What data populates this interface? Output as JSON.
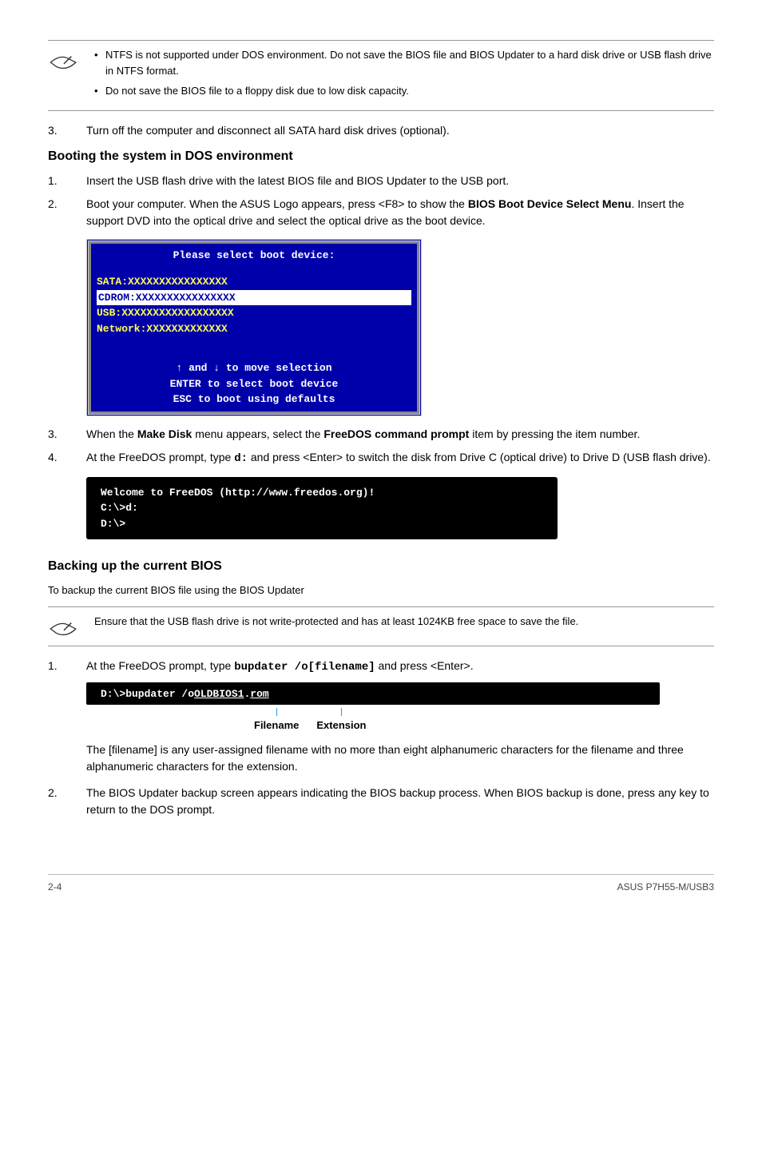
{
  "notes": {
    "top": {
      "items": [
        "NTFS is not supported under DOS environment. Do not save the BIOS file and BIOS Updater to a hard disk drive or USB flash drive in NTFS format.",
        "Do not save the BIOS file to a floppy disk due to low disk capacity."
      ]
    },
    "backup": {
      "text": "Ensure that the USB flash drive is not write-protected and has at least 1024KB free space to save the file."
    }
  },
  "step3": "Turn off the computer and disconnect all SATA hard disk drives (optional).",
  "booting": {
    "heading": "Booting the system in DOS environment",
    "steps": {
      "s1": "Insert the USB flash drive with the latest BIOS file and BIOS Updater to the USB port.",
      "s2_a": "Boot your computer. When the ASUS Logo appears, press <F8> to show the ",
      "s2_bold": "BIOS Boot Device Select Menu",
      "s2_b": ". Insert the support DVD into the optical drive and select the optical drive as the boot device.",
      "s3_a": "When the ",
      "s3_bold1": "Make Disk",
      "s3_b": " menu appears, select the ",
      "s3_bold2": "FreeDOS command prompt",
      "s3_c": " item by pressing the item number.",
      "s4_a": "At the FreeDOS prompt, type ",
      "s4_cmd": "d:",
      "s4_b": " and press <Enter> to switch the disk from Drive C (optical drive) to Drive D (USB flash drive)."
    }
  },
  "boot_menu": {
    "title": "Please select boot device:",
    "items": {
      "sata": "SATA:XXXXXXXXXXXXXXXX",
      "cdrom": "CDROM:XXXXXXXXXXXXXXXX",
      "usb": "USB:XXXXXXXXXXXXXXXXXX",
      "net": "Network:XXXXXXXXXXXXX"
    },
    "instr1": "↑ and ↓ to move selection",
    "instr2": "ENTER to select boot device",
    "instr3": "ESC to boot using defaults"
  },
  "terminal1": {
    "l1": "Welcome to FreeDOS (http://www.freedos.org)!",
    "l2": "C:\\>d:",
    "l3": "D:\\>"
  },
  "backup": {
    "heading": "Backing up the current BIOS",
    "subcaption": "To backup the current BIOS file using the BIOS Updater",
    "s1_a": "At the FreeDOS prompt, type ",
    "s1_cmd": "bupdater /o[filename]",
    "s1_b": " and press <Enter>.",
    "terminal_pre": "D:\\>bupdater /o",
    "terminal_fn": "OLDBIOS1",
    "terminal_dot": ".",
    "terminal_ext": "rom",
    "label_fn": "Filename",
    "label_ext": "Extension",
    "explain": "The [filename] is any user-assigned filename with no more than eight alphanumeric characters for the filename and three alphanumeric characters for the extension.",
    "s2": "The BIOS Updater backup screen appears indicating the BIOS backup process. When BIOS backup is done, press any key to return to the DOS prompt."
  },
  "footer": {
    "page": "2-4",
    "product": "ASUS P7H55-M/USB3"
  }
}
